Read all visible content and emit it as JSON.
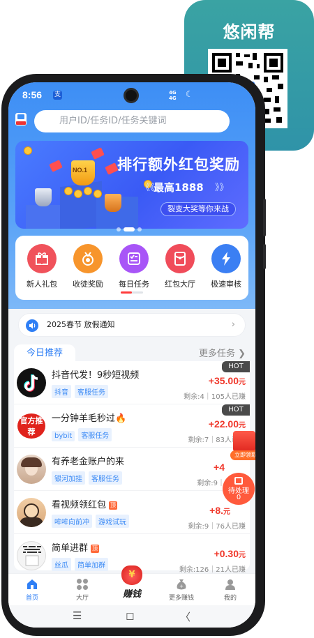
{
  "status_bar": {
    "time": "8:56",
    "app_badge": "支",
    "network": "4G\n4G"
  },
  "qr_promo": {
    "title": "悠闲帮"
  },
  "search": {
    "placeholder": "用户ID/任务ID/任务关键词"
  },
  "banner": {
    "badge": "NO.1",
    "title": "排行额外红包奖励",
    "subtitle": "最高1888",
    "chevron_left": "《《",
    "chevron_right": "》》",
    "pill": "裂变大奖等你来战"
  },
  "quick_actions": [
    {
      "label": "新人礼包",
      "icon": "gift-icon",
      "color": "#f0525b"
    },
    {
      "label": "收徒奖励",
      "icon": "medal-icon",
      "color": "#f7952c"
    },
    {
      "label": "每日任务",
      "icon": "checklist-icon",
      "color": "#a855f7"
    },
    {
      "label": "红包大厅",
      "icon": "red-envelope-icon",
      "color": "#f04c5a"
    },
    {
      "label": "极速审核",
      "icon": "lightning-icon",
      "color": "#3b7ff3"
    }
  ],
  "notice": {
    "text": "2025春节 放假通知"
  },
  "section": {
    "tab": "今日推荐",
    "more": "更多任务 ❯"
  },
  "tasks": [
    {
      "title": "抖音代发！9秒短视频",
      "tags": [
        "抖音",
        "客服任务"
      ],
      "reward": "+35.00",
      "unit": "元",
      "remain": "剩余:4｜105人已赚",
      "hot": "HOT"
    },
    {
      "title": "一分钟羊毛秒过🔥",
      "tags": [
        "bybit",
        "客服任务"
      ],
      "reward": "+22.00",
      "unit": "元",
      "remain": "剩余:7｜83人已赚",
      "hot": "HOT",
      "avatar_text": "官方推荐"
    },
    {
      "title": "有养老金账户的来",
      "tags": [
        "银河加挂",
        "客服任务"
      ],
      "reward": "+4",
      "unit": "",
      "remain": "剩余:9｜",
      "hot": ""
    },
    {
      "title": "看视频领红包",
      "tags": [
        "哞哞向前冲",
        "游戏试玩"
      ],
      "reward": "+8.",
      "unit": "元",
      "remain": "剩余:9｜76人已赚",
      "hot": "",
      "top_badge": "顶"
    },
    {
      "title": "简单进群",
      "tags": [
        "丝瓜",
        "简单加群"
      ],
      "reward": "+0.30",
      "unit": "元",
      "remain": "剩余:126｜21人已赚",
      "hot": "",
      "top_badge": "顶"
    }
  ],
  "floating": {
    "red_label": "立即领取",
    "pending_label": "待处理",
    "pending_count": "0"
  },
  "bottom_nav": [
    {
      "label": "首页",
      "icon": "home-icon"
    },
    {
      "label": "大厅",
      "icon": "grid-icon"
    },
    {
      "label": "赚钱",
      "icon": "money-bag-icon"
    },
    {
      "label": "更多赚钱",
      "icon": "coin-bag-icon"
    },
    {
      "label": "我的",
      "icon": "user-icon"
    }
  ],
  "system_nav": {
    "menu": "☰",
    "home": "◻",
    "back": "〈"
  }
}
